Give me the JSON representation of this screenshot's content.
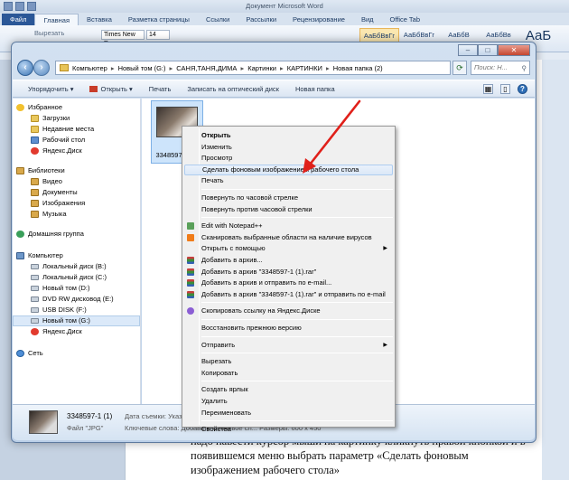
{
  "word": {
    "title": "Документ Microsoft Word",
    "tabs": [
      "Файл",
      "Главная",
      "Вставка",
      "Разметка страницы",
      "Ссылки",
      "Рассылки",
      "Рецензирование",
      "Вид",
      "Office Tab"
    ],
    "clipboard_label": "Вырезать",
    "font_name": "Times New Rc",
    "font_size": "14",
    "styles": [
      "АаБбВвГг",
      "АаБбВвГг",
      "АаБбВ",
      "АаБбВв",
      "АаБ"
    ],
    "body_text": "надо навести курсор мыши на картинку кликнуть правой кнопкой и в появившемся меню выбрать параметр «Сделать фоновым изображением рабочего стола»"
  },
  "explorer": {
    "window_buttons": [
      "–",
      "□",
      "✕"
    ],
    "address": [
      "Компьютер",
      "Новый том (G:)",
      "САНЯ,ТАНЯ,ДИМА",
      "Картинки",
      "КАРТИНКИ",
      "Новая папка (2)"
    ],
    "search_placeholder": "Поиск: Н...",
    "toolbar": [
      "Упорядочить ▾",
      "Открыть ▾",
      "Печать",
      "Записать на оптический диск",
      "Новая папка"
    ],
    "nav": {
      "favorites_header": "Избранное",
      "favorites": [
        "Загрузки",
        "Недавние места",
        "Рабочий стол",
        "Яндекс.Диск"
      ],
      "libraries_header": "Библиотеки",
      "libraries": [
        "Видео",
        "Документы",
        "Изображения",
        "Музыка"
      ],
      "homegroup": "Домашняя группа",
      "computer_header": "Компьютер",
      "drives": [
        "Локальный диск (B:)",
        "Локальный диск (C:)",
        "Новый том (D:)",
        "DVD RW дисковод (E:)",
        "USB DISK (F:)",
        "Новый том (G:)",
        "Яндекс.Диск"
      ],
      "network": "Сеть"
    },
    "file_name": "3348597-1 (1)",
    "details": {
      "name": "3348597-1 (1)",
      "type": "Файл \"JPG\"",
      "date": "Дата съемки: Указ...",
      "keywords": "Ключевые слова: Добавьте ключевое сл...   Размеры: 600 x 450"
    }
  },
  "context_menu": {
    "items": [
      {
        "label": "Открыть",
        "bold": true
      },
      {
        "label": "Изменить"
      },
      {
        "label": "Просмотр"
      },
      {
        "label": "Сделать фоновым изображением рабочего стола",
        "highlight": true
      },
      {
        "label": "Печать"
      },
      {
        "sep": true
      },
      {
        "label": "Повернуть по часовой стрелке"
      },
      {
        "label": "Повернуть против часовой стрелки"
      },
      {
        "sep": true
      },
      {
        "label": "Edit with Notepad++",
        "icon": "notepad-icon"
      },
      {
        "label": "Сканировать выбранные области на наличие вирусов",
        "icon": "antivirus-icon"
      },
      {
        "label": "Открыть с помощью",
        "submenu": true
      },
      {
        "label": "Добавить в архив...",
        "icon": "rar-icon"
      },
      {
        "label": "Добавить в архив \"3348597-1 (1).rar\"",
        "icon": "rar-icon"
      },
      {
        "label": "Добавить в архив и отправить по e-mail...",
        "icon": "rar-icon"
      },
      {
        "label": "Добавить в архив \"3348597-1 (1).rar\" и отправить по e-mail",
        "icon": "rar-icon"
      },
      {
        "sep": true
      },
      {
        "label": "Скопировать ссылку на Яндекс.Диске",
        "icon": "link-icon"
      },
      {
        "sep": true
      },
      {
        "label": "Восстановить прежнюю версию"
      },
      {
        "sep": true
      },
      {
        "label": "Отправить",
        "submenu": true
      },
      {
        "sep": true
      },
      {
        "label": "Вырезать"
      },
      {
        "label": "Копировать"
      },
      {
        "sep": true
      },
      {
        "label": "Создать ярлык"
      },
      {
        "label": "Удалить"
      },
      {
        "label": "Переименовать"
      },
      {
        "sep": true
      },
      {
        "label": "Свойства"
      }
    ]
  },
  "colors": {
    "highlight_border": "#aecdf0",
    "annotation_arrow": "#e0201a"
  }
}
